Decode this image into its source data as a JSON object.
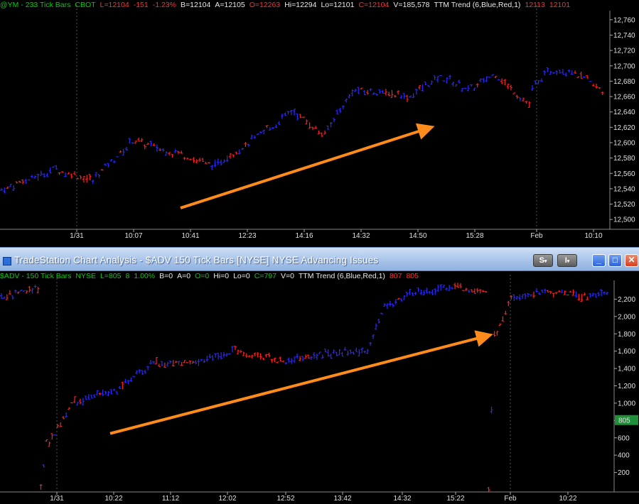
{
  "top": {
    "info": [
      {
        "text": "@YM - 233 Tick Bars",
        "color": "green"
      },
      {
        "text": "CBOT",
        "color": "green"
      },
      {
        "text": "L=12104",
        "color": "red"
      },
      {
        "text": "-151",
        "color": "red"
      },
      {
        "text": "-1.23%",
        "color": "red"
      },
      {
        "text": "B=12104",
        "color": "white"
      },
      {
        "text": "A=12105",
        "color": "white"
      },
      {
        "text": "O=12263",
        "color": "red"
      },
      {
        "text": "Hi=12294",
        "color": "white"
      },
      {
        "text": "Lo=12101",
        "color": "white"
      },
      {
        "text": "C=12104",
        "color": "red"
      },
      {
        "text": "V=185,578",
        "color": "white"
      },
      {
        "text": "TTM Trend (6,Blue,Red,1)",
        "color": "white"
      },
      {
        "text": "12113",
        "color": "red"
      },
      {
        "text": "12101",
        "color": "red"
      }
    ]
  },
  "window": {
    "title": "TradeStation Chart Analysis - $ADV  150 Tick Bars [NYSE] NYSE Advancing Issues",
    "s_button": "S",
    "i_button": "I",
    "minimize": "_",
    "maximize": "□",
    "close": "✕"
  },
  "bottom": {
    "info": [
      {
        "text": "$ADV - 150 Tick Bars",
        "color": "green"
      },
      {
        "text": "NYSE",
        "color": "green"
      },
      {
        "text": "L=805",
        "color": "green"
      },
      {
        "text": "8",
        "color": "green"
      },
      {
        "text": "1.00%",
        "color": "green"
      },
      {
        "text": "B=0",
        "color": "white"
      },
      {
        "text": "A=0",
        "color": "white"
      },
      {
        "text": "O=0",
        "color": "green"
      },
      {
        "text": "Hi=0",
        "color": "white"
      },
      {
        "text": "Lo=0",
        "color": "white"
      },
      {
        "text": "C=797",
        "color": "green"
      },
      {
        "text": "V=0",
        "color": "white"
      },
      {
        "text": "TTM Trend (6,Blue,Red,1)",
        "color": "white"
      },
      {
        "text": "807",
        "color": "red"
      },
      {
        "text": "805",
        "color": "red"
      }
    ],
    "last_value_badge": "805"
  },
  "colors": {
    "up": "#2a2aff",
    "down": "#ff2020",
    "arrow": "#ff8c1a",
    "grid": "#3a3a3a",
    "badge": "#1f8f3a"
  },
  "chart_data": [
    {
      "type": "bar",
      "symbol": "@YM",
      "ylim": [
        12490,
        12770
      ],
      "y_ticks": [
        12500,
        12520,
        12540,
        12560,
        12580,
        12600,
        12620,
        12640,
        12660,
        12680,
        12700,
        12720,
        12740,
        12760
      ],
      "y_tick_labels": [
        "12,500",
        "12,520",
        "12,540",
        "12,560",
        "12,580",
        "12,600",
        "12,620",
        "12,640",
        "12,660",
        "12,680",
        "12,700",
        "12,720",
        "12,740",
        "12,760"
      ],
      "x_tick_labels": [
        "1/31",
        "10:07",
        "10:41",
        "12:23",
        "14:16",
        "14:32",
        "14:50",
        "15:28",
        "Feb",
        "10:10"
      ],
      "session_breaks": [
        "1/31",
        "Feb"
      ],
      "trend_arrow": {
        "from": [
          4.8,
          12515
        ],
        "to": [
          11.9,
          12618
        ]
      },
      "series": [
        {
          "n": 8,
          "start": 12538,
          "end": 12550,
          "trend": "mixed"
        },
        {
          "n": 10,
          "start": 12550,
          "end": 12565,
          "trend": "up"
        },
        {
          "n": 12,
          "start": 12565,
          "end": 12552,
          "trend": "down"
        },
        {
          "n": 14,
          "start": 12552,
          "end": 12602,
          "trend": "up"
        },
        {
          "n": 14,
          "start": 12602,
          "end": 12586,
          "trend": "down"
        },
        {
          "n": 12,
          "start": 12586,
          "end": 12570,
          "trend": "down"
        },
        {
          "n": 8,
          "start": 12570,
          "end": 12590,
          "trend": "up"
        },
        {
          "n": 10,
          "start": 12590,
          "end": 12618,
          "trend": "up"
        },
        {
          "n": 8,
          "start": 12618,
          "end": 12640,
          "trend": "up"
        },
        {
          "n": 10,
          "start": 12640,
          "end": 12612,
          "trend": "down"
        },
        {
          "n": 10,
          "start": 12612,
          "end": 12668,
          "trend": "up"
        },
        {
          "n": 10,
          "start": 12668,
          "end": 12665,
          "trend": "up"
        },
        {
          "n": 8,
          "start": 12665,
          "end": 12660,
          "trend": "down"
        },
        {
          "n": 10,
          "start": 12660,
          "end": 12685,
          "trend": "up"
        },
        {
          "n": 10,
          "start": 12685,
          "end": 12670,
          "trend": "up"
        },
        {
          "n": 8,
          "start": 12670,
          "end": 12688,
          "trend": "up"
        },
        {
          "n": 12,
          "start": 12688,
          "end": 12650,
          "trend": "down"
        },
        {
          "n": 6,
          "start": 12670,
          "end": 12692,
          "trend": "up"
        },
        {
          "n": 8,
          "start": 12692,
          "end": 12695,
          "trend": "up"
        },
        {
          "n": 10,
          "start": 12690,
          "end": 12668,
          "trend": "down"
        }
      ]
    },
    {
      "type": "bar",
      "symbol": "$ADV",
      "ylim": [
        0,
        2400
      ],
      "y_ticks": [
        200,
        400,
        600,
        800,
        1000,
        1200,
        1400,
        1600,
        1800,
        2000,
        2200
      ],
      "y_tick_labels": [
        "200",
        "400",
        "600",
        "800",
        "1,000",
        "1,200",
        "1,400",
        "1,600",
        "1,800",
        "2,000",
        "2,200"
      ],
      "x_tick_labels": [
        "1/31",
        "10:22",
        "11:12",
        "12:02",
        "12:52",
        "13:42",
        "14:32",
        "15:22",
        "Feb",
        "10:22"
      ],
      "session_breaks": [
        "1/31",
        "Feb"
      ],
      "trend_arrow": {
        "from": [
          2.3,
          650
        ],
        "to": [
          14.8,
          1770
        ]
      },
      "series": [
        {
          "n": 14,
          "start": 2230,
          "end": 2330,
          "trend": "mixed"
        },
        {
          "n": 3,
          "start": 0,
          "end": 550,
          "trend": "down"
        },
        {
          "n": 10,
          "start": 550,
          "end": 1050,
          "trend": "down"
        },
        {
          "n": 14,
          "start": 1000,
          "end": 1150,
          "trend": "up"
        },
        {
          "n": 14,
          "start": 1150,
          "end": 1470,
          "trend": "up"
        },
        {
          "n": 14,
          "start": 1470,
          "end": 1450,
          "trend": "down"
        },
        {
          "n": 14,
          "start": 1450,
          "end": 1600,
          "trend": "up"
        },
        {
          "n": 18,
          "start": 1600,
          "end": 1490,
          "trend": "down"
        },
        {
          "n": 18,
          "start": 1490,
          "end": 1580,
          "trend": "up"
        },
        {
          "n": 12,
          "start": 1580,
          "end": 1610,
          "trend": "up"
        },
        {
          "n": 6,
          "start": 1700,
          "end": 2120,
          "trend": "up"
        },
        {
          "n": 10,
          "start": 2120,
          "end": 2270,
          "trend": "up"
        },
        {
          "n": 14,
          "start": 2270,
          "end": 2340,
          "trend": "up"
        },
        {
          "n": 12,
          "start": 2340,
          "end": 2280,
          "trend": "down"
        },
        {
          "n": 3,
          "start": 0,
          "end": 1800,
          "trend": "down"
        },
        {
          "n": 6,
          "start": 1800,
          "end": 2200,
          "trend": "down"
        },
        {
          "n": 12,
          "start": 2200,
          "end": 2300,
          "trend": "up"
        },
        {
          "n": 14,
          "start": 2300,
          "end": 2240,
          "trend": "down"
        },
        {
          "n": 8,
          "start": 2240,
          "end": 2270,
          "trend": "up"
        }
      ]
    }
  ]
}
